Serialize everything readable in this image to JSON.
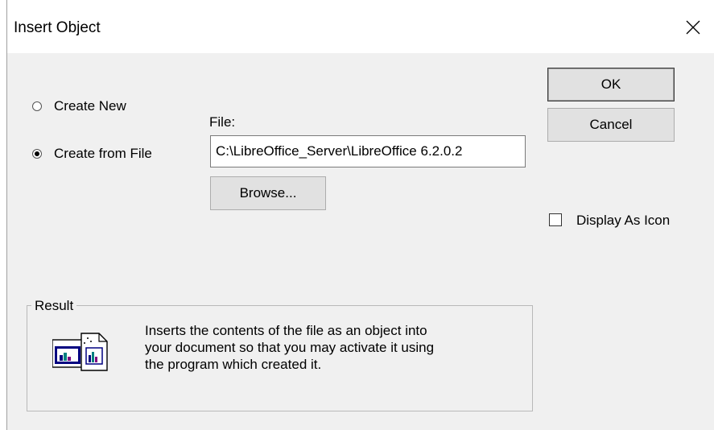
{
  "dialog": {
    "title": "Insert Object",
    "close_icon": "close-icon"
  },
  "options": {
    "create_new": {
      "label": "Create New",
      "selected": false
    },
    "create_from_file": {
      "label": "Create from File",
      "selected": true
    }
  },
  "file": {
    "label": "File:",
    "value": "C:\\LibreOffice_Server\\LibreOffice 6.2.0.2",
    "browse_label": "Browse..."
  },
  "buttons": {
    "ok_label": "OK",
    "cancel_label": "Cancel"
  },
  "display_as_icon": {
    "label": "Display As Icon",
    "checked": false
  },
  "result": {
    "legend": "Result",
    "line1": "Inserts the contents of the file as an object into",
    "line2": "your document so that you may activate it using",
    "line3": "the program which created it.",
    "icon": "linked-document-icon"
  }
}
